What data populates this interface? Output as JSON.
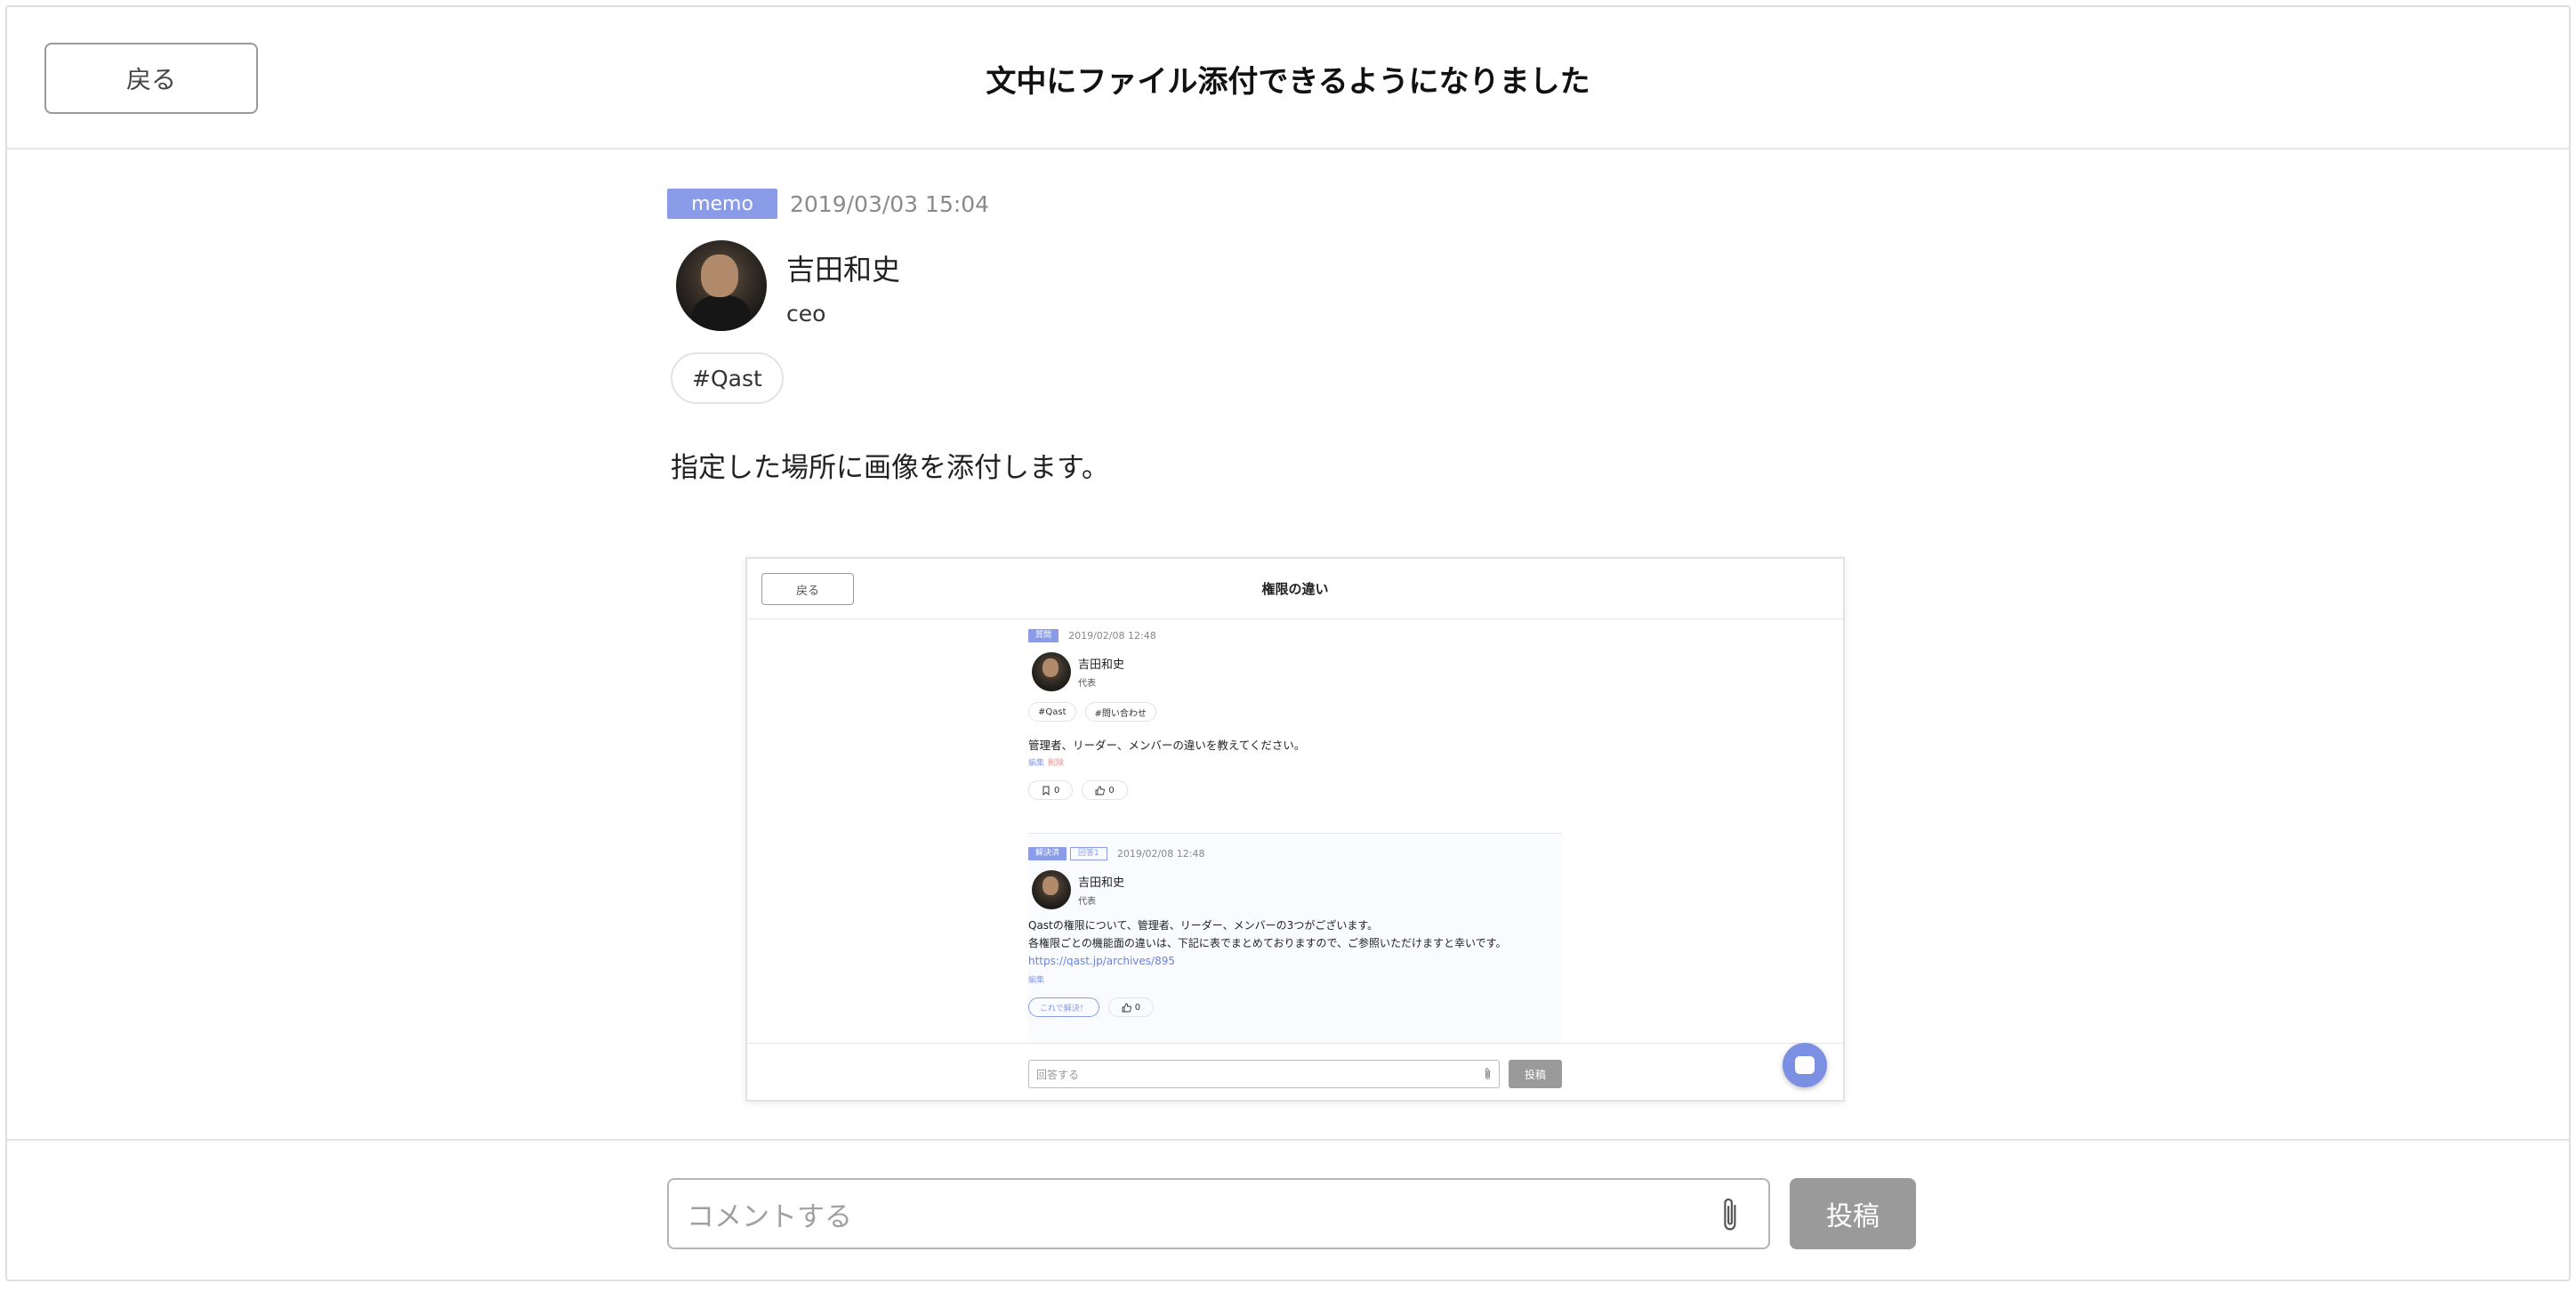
{
  "header": {
    "back_label": "戻る",
    "title": "文中にファイル添付できるようになりました"
  },
  "post": {
    "type_badge": "memo",
    "date": "2019/03/03 15:04",
    "author_name": "吉田和史",
    "author_role": "ceo",
    "tag": "#Qast",
    "body": "指定した場所に画像を添付します。"
  },
  "embedded": {
    "back_label": "戻る",
    "title": "権限の違い",
    "question": {
      "badge": "質問",
      "date": "2019/02/08 12:48",
      "author_name": "吉田和史",
      "author_role": "代表",
      "tags": [
        "#Qast",
        "#問い合わせ"
      ],
      "text": "管理者、リーダー、メンバーの違いを教えてください。",
      "edit_link": "編集",
      "delete_link": "削除",
      "bookmark_count": "0",
      "like_count": "0"
    },
    "answer": {
      "badge": "解決済",
      "outline_badge": "回答1",
      "date": "2019/02/08 12:48",
      "author_name": "吉田和史",
      "author_role": "代表",
      "line1": "Qastの権限について、管理者、リーダー、メンバーの3つがございます。",
      "line2": "各権限ごとの機能面の違いは、下記に表でまとめておりますので、ご参照いただけますと幸いです。",
      "link": "https://qast.jp/archives/895",
      "edit_link": "編集",
      "solve_label": "これで解決！",
      "like_count": "0"
    },
    "input_placeholder": "回答する",
    "post_label": "投稿"
  },
  "footer": {
    "comment_placeholder": "コメントする",
    "post_label": "投稿"
  },
  "colors": {
    "accent": "#8a9be8",
    "button_gray": "#9a9a9a",
    "chat_button": "#7b90e3"
  },
  "icons": [
    "paperclip-icon",
    "bookmark-icon",
    "thumbs-up-icon",
    "chat-icon"
  ]
}
